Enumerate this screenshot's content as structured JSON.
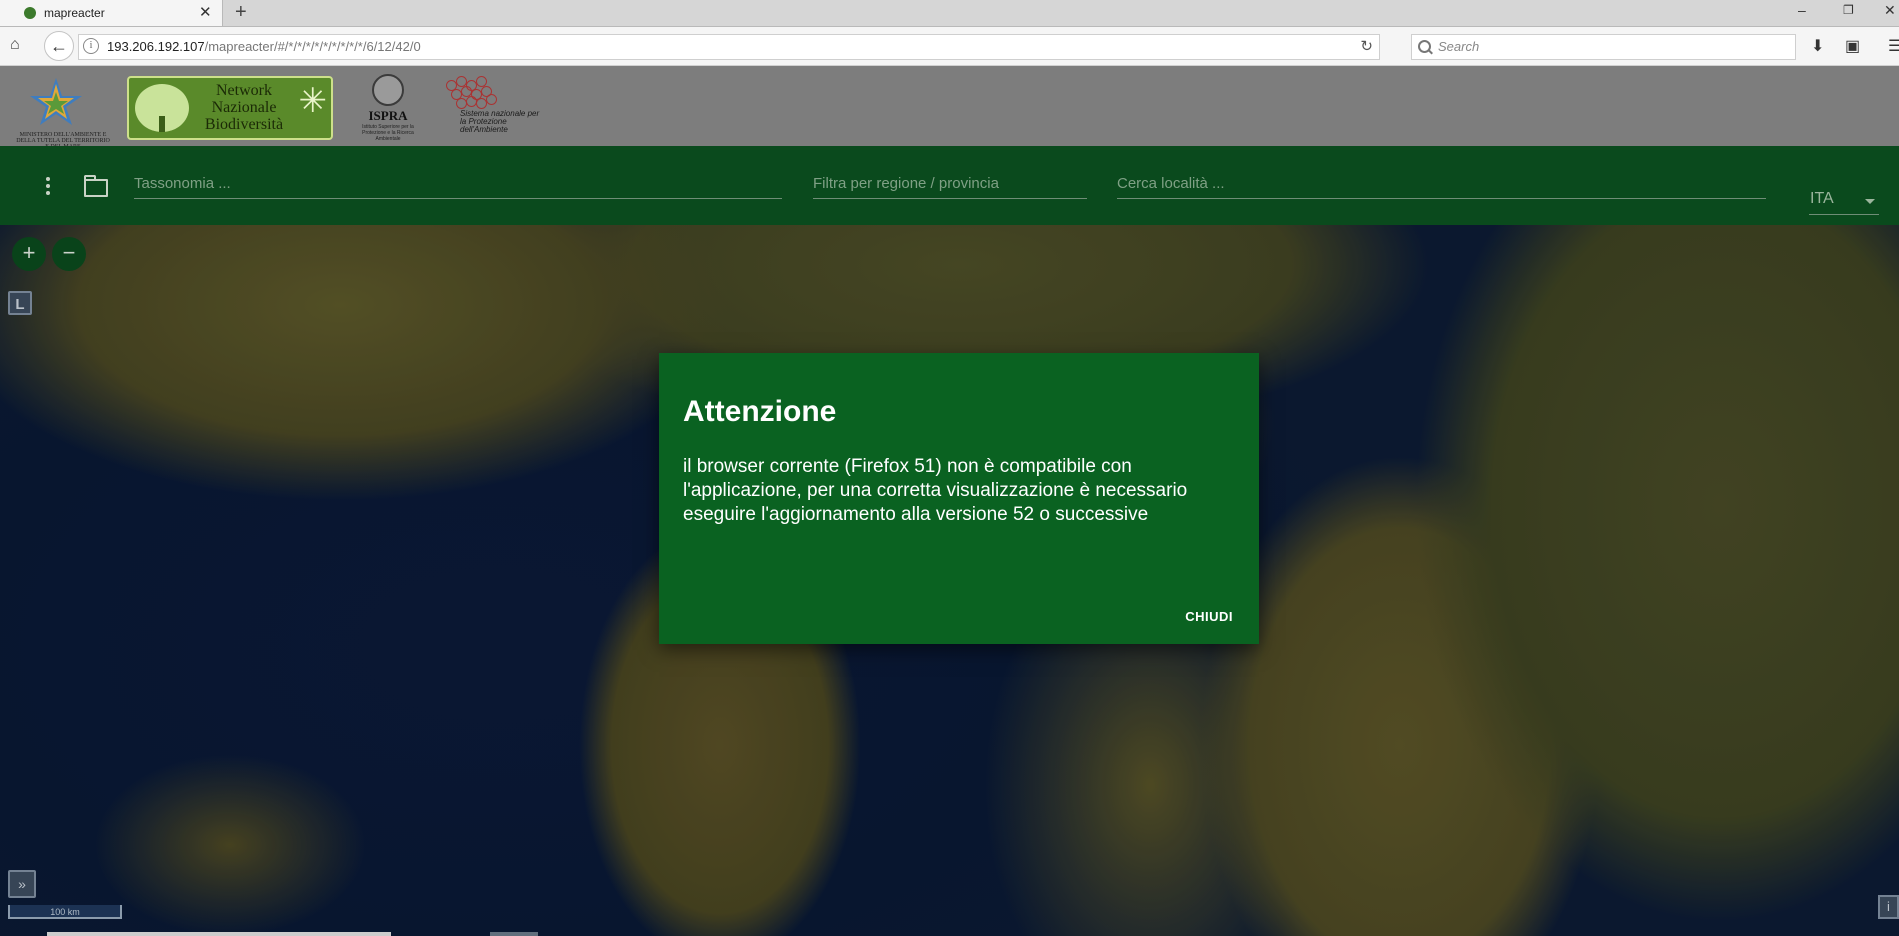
{
  "browser": {
    "tab_title": "mapreacter",
    "new_tab_label": "+",
    "url_host": "193.206.192.107",
    "url_path": "/mapreacter/#/*/*/*/*/*/*/*/*/*/6/12/42/0",
    "search_placeholder": "Search",
    "window_controls": [
      "–",
      "❐",
      "✕"
    ]
  },
  "logos": {
    "ministero_caption": "MINISTERO DELL'AMBIENTE E DELLA TUTELA DEL TERRITORIO E DEL MARE",
    "network_text": "Network Nazionale Biodiversità",
    "ispra_text": "ISPRA",
    "ispra_sub": "Istituto Superiore per la Protezione e la Ricerca Ambientale",
    "snpa_text": "Sistema nazionale per la Protezione dell'Ambiente"
  },
  "toolbar": {
    "taxonomy_placeholder": "Tassonomia ...",
    "region_placeholder": "Filtra per regione / provincia",
    "locality_placeholder": "Cerca località ...",
    "language": "ITA"
  },
  "map": {
    "zoom_in": "+",
    "zoom_out": "−",
    "layer_label": "L",
    "expand_label": "»",
    "scale_label": "100 km",
    "info_label": "i"
  },
  "modal": {
    "title": "Attenzione",
    "body": "il browser corrente (Firefox 51) non è compatibile con l'applicazione, per una corretta visualizzazione è necessario eseguire l'aggiornamento alla versione 52 o successive",
    "close_label": "CHIUDI"
  },
  "colors": {
    "toolbar_green": "#0a4a1d",
    "modal_green": "#0a6221",
    "header_gray": "#7d7d7d"
  }
}
